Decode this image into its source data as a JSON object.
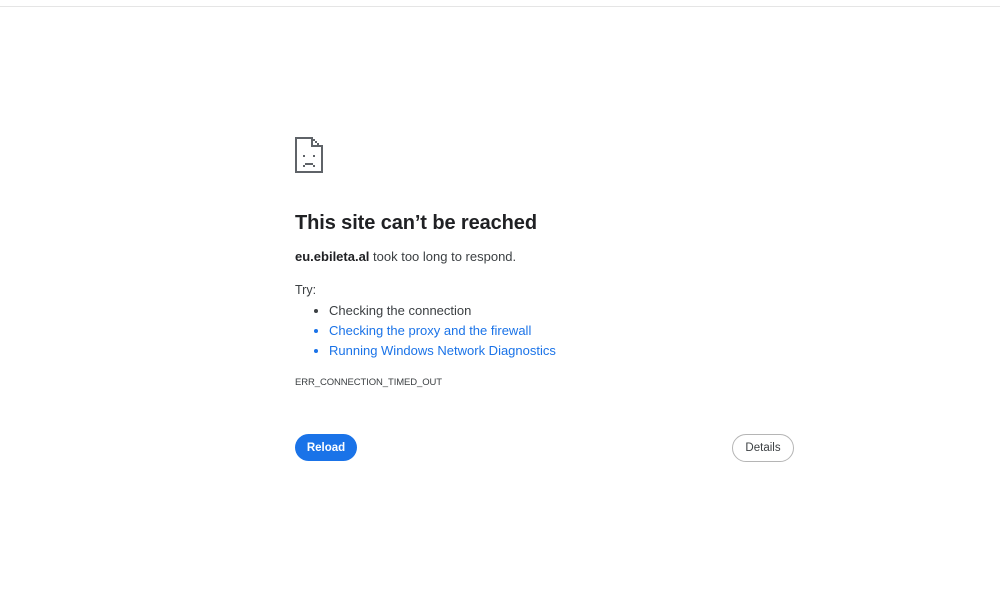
{
  "error": {
    "icon": "sad-page-icon",
    "title": "This site can’t be reached",
    "host": "eu.ebileta.al",
    "message": " took too long to respond.",
    "try_label": "Try:",
    "suggestions": [
      {
        "label": "Checking the connection",
        "link": false
      },
      {
        "label": "Checking the proxy and the firewall",
        "link": true
      },
      {
        "label": "Running Windows Network Diagnostics",
        "link": true
      }
    ],
    "code": "ERR_CONNECTION_TIMED_OUT"
  },
  "buttons": {
    "reload_label": "Reload",
    "details_label": "Details"
  },
  "colors": {
    "accent": "#1a73e8",
    "title": "#202124",
    "text": "#3c4043"
  }
}
